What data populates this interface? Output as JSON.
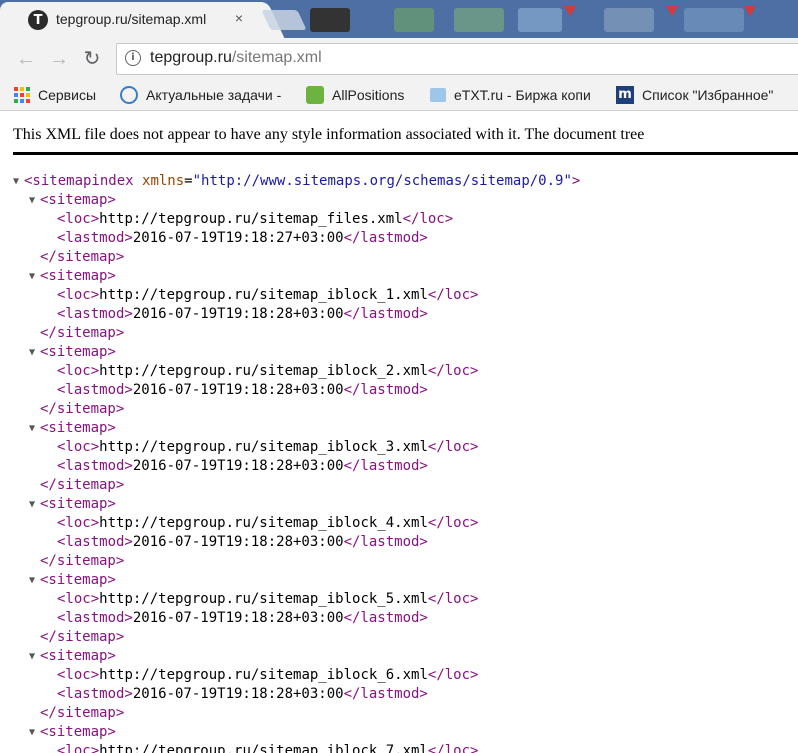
{
  "tab": {
    "title": "tepgroup.ru/sitemap.xml",
    "close": "×",
    "favicon_letter": "T"
  },
  "toolbar": {
    "back": "←",
    "forward": "→",
    "reload": "↻",
    "url_host": "tepgroup.ru",
    "url_path": "/sitemap.xml",
    "info": "i"
  },
  "bookmarks": [
    {
      "label": "Сервисы",
      "icon": "apps-icon"
    },
    {
      "label": "Актуальные задачи -",
      "icon": "cloud-icon"
    },
    {
      "label": "AllPositions",
      "icon": "allpositions-icon"
    },
    {
      "label": "eTXT.ru - Биржа копи",
      "icon": "etxt-icon"
    },
    {
      "label": "Список \"Избранное\"",
      "icon": "m-icon"
    }
  ],
  "notice": "This XML file does not appear to have any style information associated with it. The document tree",
  "xml": {
    "root_open": "<sitemapindex",
    "attr_name": "xmlns",
    "attr_value": "\"http://www.sitemaps.org/schemas/sitemap/0.9\"",
    "root_close_bracket": ">",
    "sitemap_open": "<sitemap>",
    "sitemap_close": "</sitemap>",
    "loc_open": "<loc>",
    "loc_close": "</loc>",
    "lastmod_open": "<lastmod>",
    "lastmod_close": "</lastmod>",
    "entries": [
      {
        "loc": "http://tepgroup.ru/sitemap_files.xml",
        "lastmod": "2016-07-19T19:18:27+03:00"
      },
      {
        "loc": "http://tepgroup.ru/sitemap_iblock_1.xml",
        "lastmod": "2016-07-19T19:18:28+03:00"
      },
      {
        "loc": "http://tepgroup.ru/sitemap_iblock_2.xml",
        "lastmod": "2016-07-19T19:18:28+03:00"
      },
      {
        "loc": "http://tepgroup.ru/sitemap_iblock_3.xml",
        "lastmod": "2016-07-19T19:18:28+03:00"
      },
      {
        "loc": "http://tepgroup.ru/sitemap_iblock_4.xml",
        "lastmod": "2016-07-19T19:18:28+03:00"
      },
      {
        "loc": "http://tepgroup.ru/sitemap_iblock_5.xml",
        "lastmod": "2016-07-19T19:18:28+03:00"
      },
      {
        "loc": "http://tepgroup.ru/sitemap_iblock_6.xml",
        "lastmod": "2016-07-19T19:18:28+03:00"
      },
      {
        "loc": "http://tepgroup.ru/sitemap_iblock_7.xml",
        "lastmod": ""
      }
    ]
  }
}
